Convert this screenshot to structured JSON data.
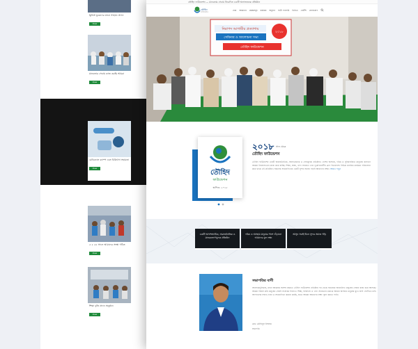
{
  "background_page": {
    "cards": [
      {
        "title": "ক্ষুধার্ত যুবকদের মাঝে সাহায্য প্রদান",
        "button": "View"
      },
      {
        "title": "মানবতার সেবায় কাজ করছি আমরা",
        "button": "View"
      },
      {
        "title": "মেডিক্যাল ক্যাম্প এবং চিকিৎসা সহায়তা",
        "button": "View"
      },
      {
        "title": "৫ ৫ ৫৫ সালে আমাদের সংস্থা গঠিত",
        "button": "View"
      },
      {
        "title": "শিক্ষা বৃত্তি প্রদান অনুষ্ঠান",
        "button": "View"
      }
    ]
  },
  "site": {
    "topbar_text": "তৌহিদ ফাউন্ডেশন — মানবতার সেবায় নিবেদিত একটি অলাভজনক প্রতিষ্ঠান",
    "logo": {
      "name": "তৌহিদ",
      "sub": "ফাউন্ডেশন"
    },
    "nav": [
      "হোম",
      "আমাদের",
      "প্রকল্পসমূহ",
      "কার্যক্রম",
      "অনুদান",
      "ফটো গ্যালারি",
      "ভিডিও",
      "নোটিশ",
      "যোগাযোগ"
    ],
    "hero": {
      "banner_line1": "নিরাপদ আগামীর প্রত্যাশায়",
      "banner_line2": "সেমিনার ও আলোচনা সভা",
      "banner_line3": "তৌহিদ ফাউন্ডেশন",
      "banner_badge": "২০১৮"
    },
    "intro": {
      "card_title": "তৌহিদ",
      "card_sub": "ফাউন্ডেশন",
      "card_year": "স্থাপিত: ২০১৮",
      "year": "২০১৮",
      "year_sub": "সাল থেকে",
      "org_name": "তৌহিদ ফাউন্ডেশন",
      "paragraph": "তৌহিদ ফাউন্ডেশন একটি অরাজনৈতিক, অলাভজনক ও সেবামূলক প্রতিষ্ঠান। দেশের অসহায়, দরিদ্র ও সুবিধাবঞ্চিত মানুষের কল্যাণে আমরা নিরলসভাবে কাজ করে যাচ্ছি। শিক্ষা, স্বাস্থ্য, খাদ্য সহায়তা এবং দুর্যোগকালীন ত্রাণ বিতরণসহ বিভিন্ন মানবিক কার্যক্রম পরিচালনা করে থাকে এই প্রতিষ্ঠান। সকলের সহযোগিতায় একটি সুন্দর সমাজ গড়াই আমাদের লক্ষ্য।",
      "more": "আরও পড়ুন"
    },
    "band": [
      "একটি অসাম্প্রদায়িক, অরাজনৈতিক ও মানবকল্যাণমূলক প্রতিষ্ঠান",
      "দরিদ্র ও অসহায় মানুষের পাশে দাঁড়ানো আমাদের মূল লক্ষ্য",
      "আসুন সবাই মিলে সুন্দর সমাজ গড়ি"
    ],
    "message": {
      "title": "সভাপতির বাণী",
      "paragraph": "আলহামদুলিল্লাহ, মহান আল্লাহর অশেষ রহমতে তৌহিদ ফাউন্ডেশন প্রতিষ্ঠার পর থেকে সমাজের অবহেলিত মানুষের সেবায় কাজ করে আসছে। আমরা বিশ্বাস করি মানুষের সেবাই সর্বোত্তম ইবাদত। শিক্ষা, চিকিৎসা ও খাদ্য সহায়তার মাধ্যমে আমরা অসহায় মানুষের মুখে হাসি ফোটাতে চাই। আপনাদের সবার দোয়া ও সহযোগিতা কামনা করছি, যাতে আমরা আমাদের লক্ষ্য পূরণ করতে পারি।",
      "signature_name": "মোঃ তৌহিদুল ইসলাম",
      "signature_role": "সভাপতি"
    }
  },
  "colors": {
    "brand_blue": "#1a73bf",
    "dark_box": "#15191d",
    "button_green": "#1e8a3a"
  }
}
